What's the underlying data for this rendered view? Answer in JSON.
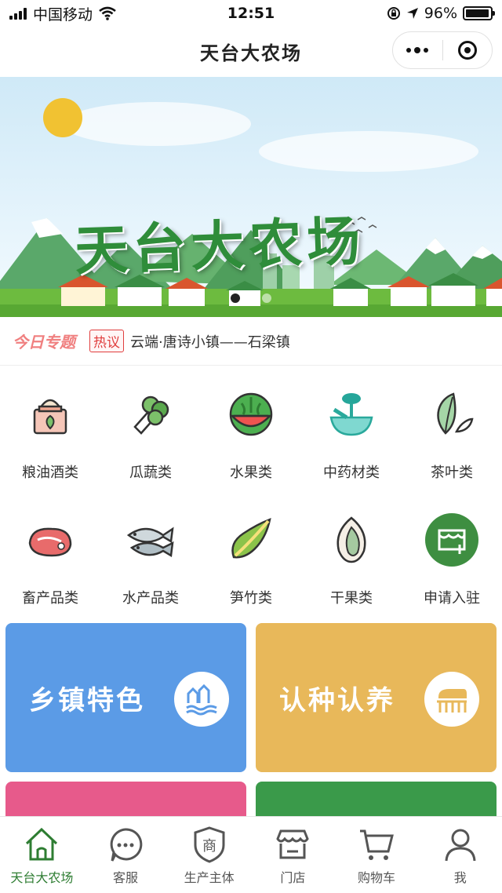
{
  "status": {
    "carrier": "中国移动",
    "time": "12:51",
    "battery": "96%",
    "battery_level": 0.96
  },
  "navbar": {
    "title": "天台大农场"
  },
  "banner": {
    "title": "天台大农场"
  },
  "topic": {
    "logo": "今日专题",
    "badge": "热议",
    "text": "云端·唐诗小镇——石梁镇"
  },
  "categories": [
    {
      "label": "粮油酒类",
      "icon": "grain-sack-icon"
    },
    {
      "label": "瓜蔬类",
      "icon": "cabbage-icon"
    },
    {
      "label": "水果类",
      "icon": "watermelon-icon"
    },
    {
      "label": "中药材类",
      "icon": "mortar-herb-icon"
    },
    {
      "label": "茶叶类",
      "icon": "tea-leaf-icon"
    },
    {
      "label": "畜产品类",
      "icon": "meat-icon"
    },
    {
      "label": "水产品类",
      "icon": "fish-icon"
    },
    {
      "label": "笋竹类",
      "icon": "bamboo-shoot-icon"
    },
    {
      "label": "干果类",
      "icon": "nut-icon"
    },
    {
      "label": "申请入驻",
      "icon": "store-add-icon"
    }
  ],
  "cards": [
    {
      "label": "乡镇特色",
      "color": "#5b9be6",
      "icon": "town-icon"
    },
    {
      "label": "认种认养",
      "color": "#e8b85a",
      "icon": "farm-animal-icon"
    }
  ],
  "tabs": [
    {
      "label": "天台大农场",
      "icon": "home-icon",
      "active": true
    },
    {
      "label": "客服",
      "icon": "chat-icon",
      "active": false
    },
    {
      "label": "生产主体",
      "icon": "shield-shop-icon",
      "active": false
    },
    {
      "label": "门店",
      "icon": "store-icon",
      "active": false
    },
    {
      "label": "购物车",
      "icon": "cart-icon",
      "active": false
    },
    {
      "label": "我",
      "icon": "user-icon",
      "active": false
    }
  ],
  "colors": {
    "accent": "#2e7d32",
    "pink": "#e75a8b",
    "green": "#3a9a4a"
  }
}
